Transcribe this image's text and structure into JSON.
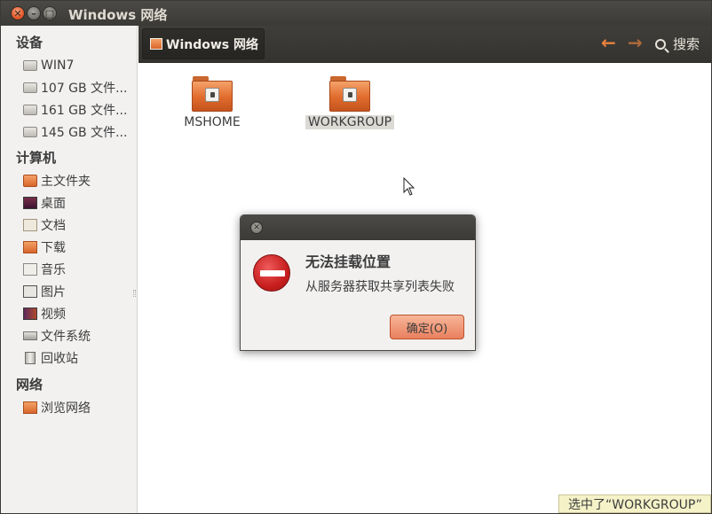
{
  "window": {
    "title": "Windows 网络"
  },
  "titlebar_buttons": {
    "close": "✕",
    "minimize": "–",
    "maximize": "□"
  },
  "sidebar": {
    "devices_header": "设备",
    "devices": [
      {
        "label": "WIN7",
        "icon": "drive-icon"
      },
      {
        "label": "107 GB 文件...",
        "icon": "drive-icon"
      },
      {
        "label": "161 GB 文件...",
        "icon": "drive-icon"
      },
      {
        "label": "145 GB 文件...",
        "icon": "drive-icon"
      }
    ],
    "computer_header": "计算机",
    "computer": [
      {
        "label": "主文件夹",
        "icon": "home-folder-icon"
      },
      {
        "label": "桌面",
        "icon": "desktop-icon"
      },
      {
        "label": "文档",
        "icon": "documents-icon"
      },
      {
        "label": "下载",
        "icon": "downloads-icon"
      },
      {
        "label": "音乐",
        "icon": "music-icon"
      },
      {
        "label": "图片",
        "icon": "pictures-icon"
      },
      {
        "label": "视频",
        "icon": "videos-icon"
      },
      {
        "label": "文件系统",
        "icon": "filesystem-icon"
      },
      {
        "label": "回收站",
        "icon": "trash-icon"
      }
    ],
    "network_header": "网络",
    "network": [
      {
        "label": "浏览网络",
        "icon": "network-icon"
      }
    ]
  },
  "toolbar": {
    "breadcrumb": "Windows 网络",
    "back_glyph": "←",
    "forward_glyph": "→",
    "search_label": "搜索"
  },
  "content": {
    "items": [
      {
        "label": "MSHOME",
        "selected": false
      },
      {
        "label": "WORKGROUP",
        "selected": true
      }
    ]
  },
  "dialog": {
    "close_glyph": "✕",
    "primary": "无法挂载位置",
    "secondary": "从服务器获取共享列表失败",
    "ok_label": "确定(O)"
  },
  "statusbar": {
    "text": "选中了“WORKGROUP”"
  },
  "colors": {
    "accent_orange": "#e06b2c",
    "titlebar_dark": "#3c3b37",
    "error_red": "#c81e1e",
    "status_yellow": "#f5f2c8"
  }
}
